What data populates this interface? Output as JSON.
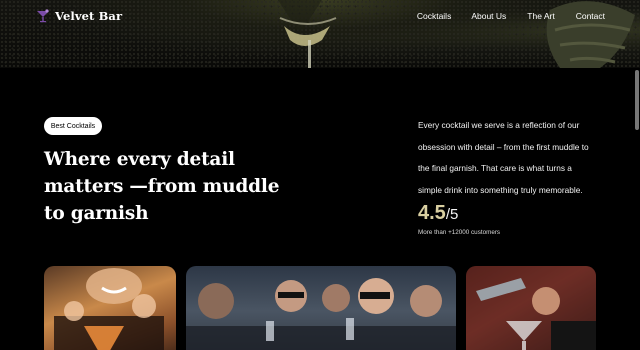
{
  "brand": {
    "name": "Velvet Bar",
    "icon": "cocktail-glass-icon"
  },
  "nav": {
    "links": [
      {
        "label": "Cocktails"
      },
      {
        "label": "About Us"
      },
      {
        "label": "The Art"
      },
      {
        "label": "Contact"
      }
    ]
  },
  "hero": {
    "badge": "Best Cocktails",
    "headline": "Where every detail matters —from muddle to garnish",
    "description": "Every cocktail we serve is a reflection of our obsession with detail – from the first muddle to the final garnish. That care is what turns a simple drink into something truly memorable.",
    "rating": {
      "value": "4.5",
      "max": "/5",
      "caption": "More than +12000 customers"
    }
  },
  "colors": {
    "background": "#000000",
    "accent": "#d9cfa1",
    "brand_icon": "#7b4ca8"
  }
}
